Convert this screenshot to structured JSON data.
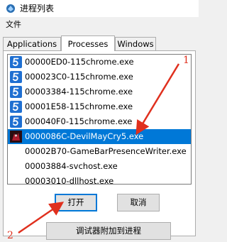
{
  "window": {
    "title": "进程列表"
  },
  "menu": {
    "items": [
      "文件"
    ]
  },
  "tabs": [
    "Applications",
    "Processes",
    "Windows"
  ],
  "active_tab": "Processes",
  "processes": [
    {
      "label": "00000ED0-115chrome.exe",
      "icon": "chrome-115-icon",
      "selected": false
    },
    {
      "label": "000023C0-115chrome.exe",
      "icon": "chrome-115-icon",
      "selected": false
    },
    {
      "label": "00003384-115chrome.exe",
      "icon": "chrome-115-icon",
      "selected": false
    },
    {
      "label": "00001E58-115chrome.exe",
      "icon": "chrome-115-icon",
      "selected": false
    },
    {
      "label": "000040F0-115chrome.exe",
      "icon": "chrome-115-icon",
      "selected": false
    },
    {
      "label": "0000086C-DevilMayCry5.exe",
      "icon": "devil-may-cry-icon",
      "selected": true
    },
    {
      "label": "00002B70-GameBarPresenceWriter.exe",
      "icon": "",
      "selected": false
    },
    {
      "label": "00003884-svchost.exe",
      "icon": "",
      "selected": false
    },
    {
      "label": "00003010-dllhost.exe",
      "icon": "",
      "selected": false
    }
  ],
  "buttons": {
    "open": "打开",
    "cancel": "取消",
    "attach_debugger": "调试器附加到进程"
  },
  "annotations": {
    "marker_1": "1",
    "marker_2": "2",
    "color": "#e0301e"
  },
  "colors": {
    "selection": "#0078d7",
    "chrome_icon": "#1f6fd1"
  }
}
